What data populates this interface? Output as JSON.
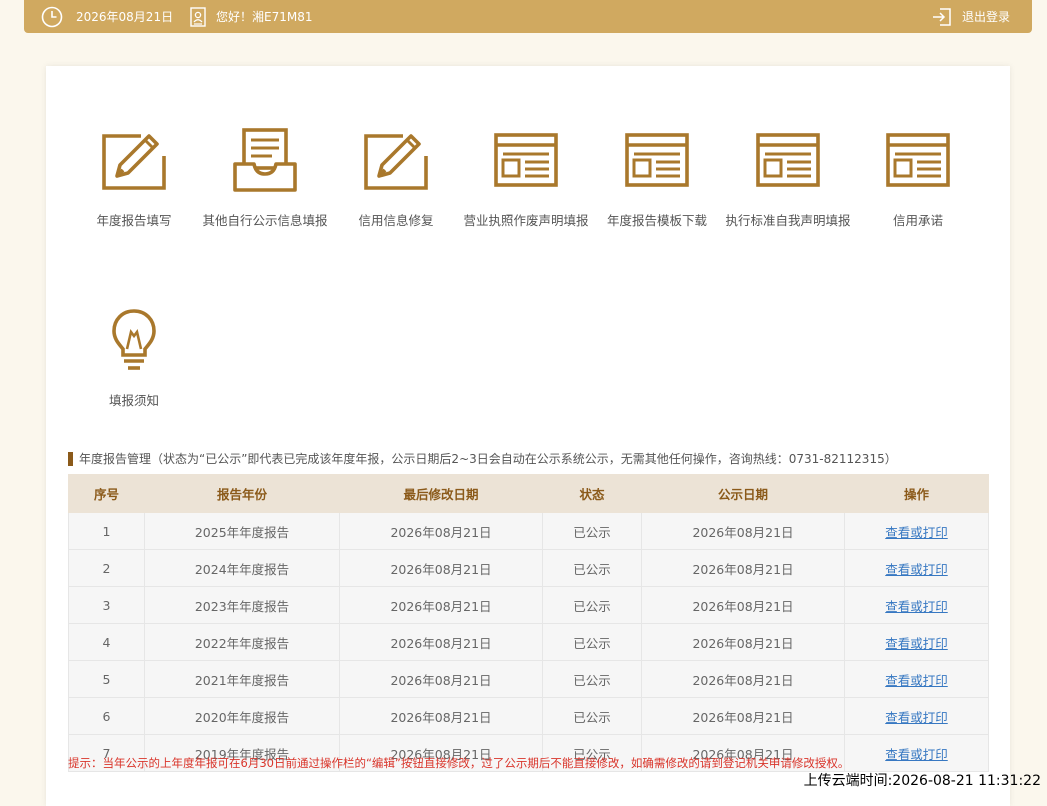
{
  "header": {
    "date": "2026年08月21日",
    "greeting": "您好！湘E71M81",
    "logout": "退出登录"
  },
  "tiles": [
    {
      "label": "年度报告填写",
      "icon": "edit-pencil-icon"
    },
    {
      "label": "其他自行公示信息填报",
      "icon": "inbox-document-icon"
    },
    {
      "label": "信用信息修复",
      "icon": "edit-pencil-icon"
    },
    {
      "label": "营业执照作废声明填报",
      "icon": "web-form-icon"
    },
    {
      "label": "年度报告模板下载",
      "icon": "web-form-icon"
    },
    {
      "label": "执行标准自我声明填报",
      "icon": "web-form-icon"
    },
    {
      "label": "信用承诺",
      "icon": "web-form-icon"
    },
    {
      "label": "填报须知",
      "icon": "lightbulb-icon"
    }
  ],
  "section": {
    "title": "年度报告管理（状态为“已公示”即代表已完成该年度年报，公示日期后2~3日会自动在公示系统公示，无需其他任何操作，咨询热线：0731-82112315）"
  },
  "table": {
    "headers": [
      "序号",
      "报告年份",
      "最后修改日期",
      "状态",
      "公示日期",
      "操作"
    ],
    "rows": [
      [
        "1",
        "2025年年度报告",
        "2026年08月21日",
        "已公示",
        "2026年08月21日",
        "查看或打印"
      ],
      [
        "2",
        "2024年年度报告",
        "2026年08月21日",
        "已公示",
        "2026年08月21日",
        "查看或打印"
      ],
      [
        "3",
        "2023年年度报告",
        "2026年08月21日",
        "已公示",
        "2026年08月21日",
        "查看或打印"
      ],
      [
        "4",
        "2022年年度报告",
        "2026年08月21日",
        "已公示",
        "2026年08月21日",
        "查看或打印"
      ],
      [
        "5",
        "2021年年度报告",
        "2026年08月21日",
        "已公示",
        "2026年08月21日",
        "查看或打印"
      ],
      [
        "6",
        "2020年年度报告",
        "2026年08月21日",
        "已公示",
        "2026年08月21日",
        "查看或打印"
      ],
      [
        "7",
        "2019年年度报告",
        "2026年08月21日",
        "已公示",
        "2026年08月21日",
        "查看或打印"
      ]
    ]
  },
  "tip": "提示：当年公示的上年度年报可在6月30日前通过操作栏的“编辑”按钮直接修改，过了公示期后不能直接修改，如确需修改的请到登记机关申请修改授权。",
  "upload_time": "上传云端时间:2026-08-21 11:31:22",
  "colors": {
    "accent": "#d0a960",
    "icon": "#a9782c",
    "link": "#3778c2",
    "warning": "#d9352b"
  }
}
